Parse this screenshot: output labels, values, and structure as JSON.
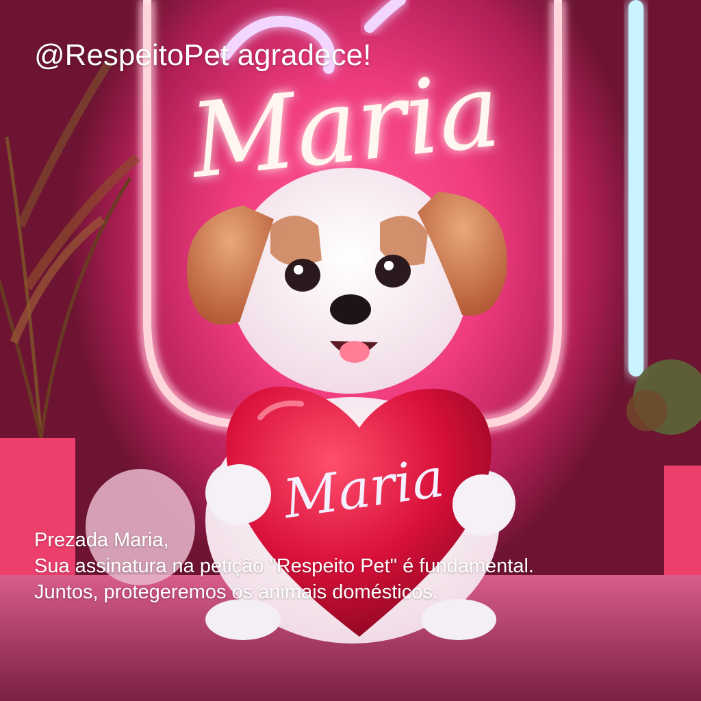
{
  "headline": "@RespeitoPet agradece!",
  "neon_sign_text": "Maria",
  "heart_text": "Maria",
  "message": {
    "greeting": "Prezada Maria,",
    "line1": "Sua assinatura na petição \"Respeito Pet\" é fundamental.",
    "line2": "Juntos, protegeremos os animais domésticos."
  },
  "colors": {
    "background_pink": "#f03c7f",
    "neon_glow": "#fff4ee",
    "heart_red": "#d8103a",
    "text": "#ffffff"
  }
}
